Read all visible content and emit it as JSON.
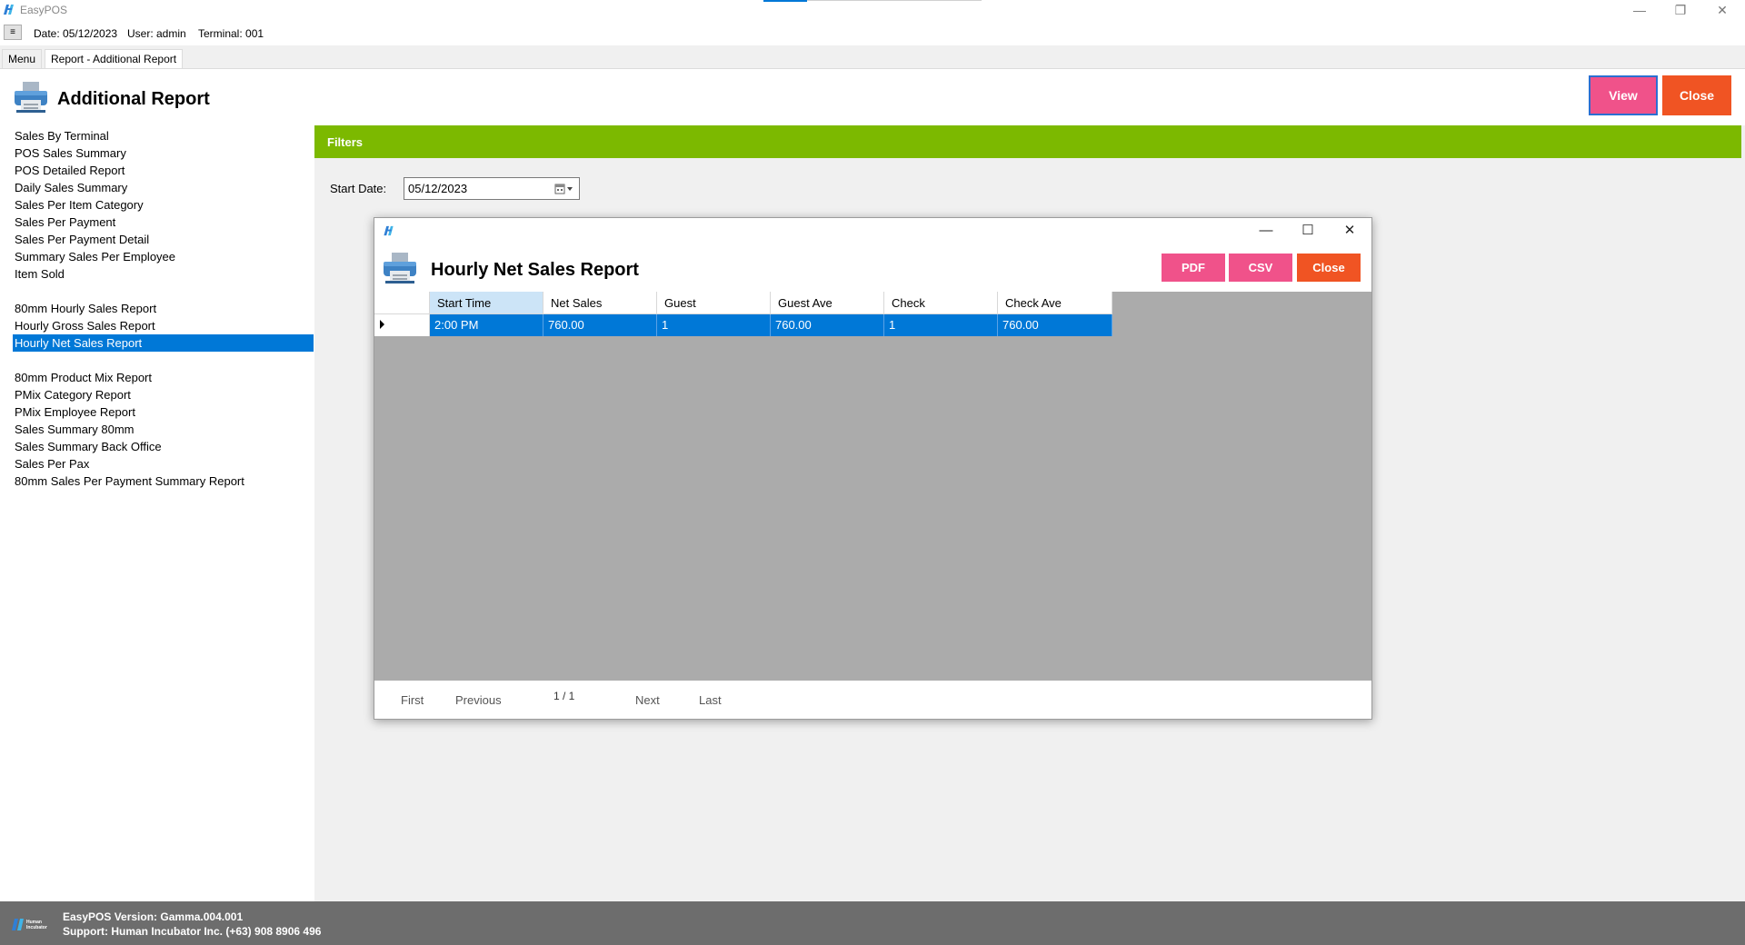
{
  "app": {
    "title": "EasyPOS"
  },
  "window_controls": {
    "minimize": "—",
    "restore": "❐",
    "close": "✕"
  },
  "info": {
    "date": "Date: 05/12/2023",
    "user": "User: admin",
    "terminal": "Terminal: 001",
    "menu_toggle": "≡"
  },
  "tabs": [
    {
      "label": "Menu"
    },
    {
      "label": "Report - Additional Report"
    }
  ],
  "header": {
    "title": "Additional Report",
    "view_label": "View",
    "close_label": "Close"
  },
  "report_list": [
    "Sales By Terminal",
    "POS Sales Summary",
    "POS Detailed Report",
    "Daily Sales Summary",
    "Sales Per Item Category",
    "Sales Per Payment",
    "Sales Per Payment Detail",
    "Summary Sales Per Employee",
    "Item Sold",
    "80mm Hourly Sales Report",
    "Hourly Gross Sales Report",
    "Hourly Net Sales Report",
    "80mm Product Mix Report",
    "PMix Category Report",
    "PMix Employee Report",
    "Sales Summary 80mm",
    "Sales Summary Back Office",
    "Sales Per Pax",
    "80mm Sales Per Payment Summary Report"
  ],
  "selected_report": "Hourly Net Sales Report",
  "filters": {
    "title": "Filters",
    "start_date_label": "Start Date:",
    "start_date_value": "05/12/2023"
  },
  "dialog": {
    "title": "Hourly Net Sales Report",
    "pdf_label": "PDF",
    "csv_label": "CSV",
    "close_label": "Close",
    "controls": {
      "minimize": "—",
      "maximize": "☐",
      "close": "✕"
    },
    "columns": [
      "Start Time",
      "Net Sales",
      "Guest",
      "Guest Ave",
      "Check",
      "Check Ave"
    ],
    "rows": [
      [
        "2:00 PM",
        "760.00",
        "1",
        "760.00",
        "1",
        "760.00"
      ]
    ],
    "pager": {
      "first": "First",
      "previous": "Previous",
      "page": "1 / 1",
      "next": "Next",
      "last": "Last"
    }
  },
  "footer": {
    "version": "EasyPOS Version: Gamma.004.001",
    "support": "Support: Human Incubator Inc. (+63) 908 8906 496",
    "logo_text": "Human Incubator"
  },
  "colors": {
    "accent_blue": "#0078d7",
    "filters_green": "#7cb900",
    "pink_button": "#f0528a",
    "orange_button": "#f05423",
    "footer_gray": "#6d6d6d"
  }
}
